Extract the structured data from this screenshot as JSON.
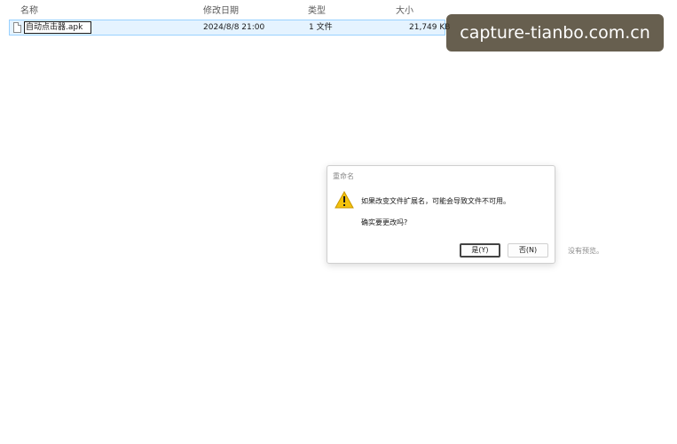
{
  "columns": {
    "name": "名称",
    "modified": "修改日期",
    "type": "类型",
    "size": "大小"
  },
  "file": {
    "name": "自动点击器.apk",
    "modified": "2024/8/8 21:00",
    "type": "1 文件",
    "size": "21,749 KB"
  },
  "watermark": "capture-tianbo.com.cn",
  "dialog": {
    "title": "重命名",
    "message": "如果改变文件扩展名，可能会导致文件不可用。",
    "question": "确实要更改吗?",
    "yes_label": "是(Y)",
    "no_label": "否(N)"
  },
  "preview": {
    "empty_text": "没有预览。"
  },
  "colors": {
    "selection_bg": "#e5f3ff",
    "selection_border": "#99d1ff",
    "warning": "#f4c20d"
  },
  "icons": {
    "file": "file-icon",
    "warning": "warning-icon"
  }
}
